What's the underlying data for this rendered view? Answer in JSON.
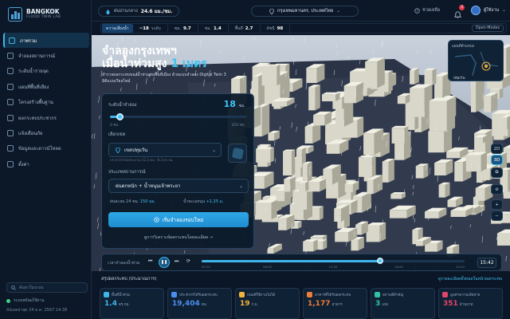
{
  "sidebar": {
    "logo_title": "BANGKOK",
    "logo_subtitle": "FLOOD TWIN LAB",
    "items": [
      {
        "label": "ภาพรวม",
        "active": true
      },
      {
        "label": "จำลองสถานการณ์"
      },
      {
        "label": "ระดับน้ำรายจุด"
      },
      {
        "label": "แผนที่พื้นที่เสี่ยง"
      },
      {
        "label": "โครงสร้างพื้นฐาน"
      },
      {
        "label": "ผลกระทบประชากร"
      },
      {
        "label": "แจ้งเตือนภัย"
      },
      {
        "label": "ข้อมูลและดาวน์โหลด"
      },
      {
        "label": "ตั้งค่า"
      }
    ],
    "search_placeholder": "ค้นหาในระบบ",
    "status": "ระบบพร้อมใช้งาน",
    "updated": "อัปเดตล่าสุด 24 ต.ค. 2567 14:38"
  },
  "topbar": {
    "rain_label": "ฝนปานกลาง",
    "rain_value": "24.6 มม./ชม.",
    "location": "กรุงเทพมหานคร, ประเทศไทย",
    "help": "ช่วยเหลือ",
    "notifications": "3",
    "user": "ผู้ใช้งาน"
  },
  "metrics": {
    "label": "ความเสี่ยงน้ำ",
    "items": [
      {
        "label": "ระดับ",
        "value": "~18"
      },
      {
        "label": "ซม.",
        "value": "9.7"
      },
      {
        "label": "ชม.",
        "value": "1.4"
      },
      {
        "label": "พื้นที่",
        "value": "2.7"
      },
      {
        "label": "ดัชนี",
        "value": "98"
      }
    ],
    "mode": "Open-Modes"
  },
  "hero": {
    "title_line1": "จำลองกรุงเทพฯ",
    "title_line2_prefix": "เมื่อน้ำท่วมสูง",
    "title_line2_highlight": "1 เมตร",
    "subtitle": "สำรวจผลกระทบของน้ำท่วมต่อพื้นที่เมือง ด้วยแบบจำลอง Digital Twin 3 มิติแบบเรียลไทม์"
  },
  "panel": {
    "level_label": "ระดับน้ำจำลอง",
    "level_value": "18",
    "level_unit": "ซม.",
    "level_fraction": 0.07,
    "min_label": "0 ซม.",
    "max_label": "250 ซม.",
    "district_label": "เลือกเขต",
    "district_value": "เขตปทุมวัน",
    "district_note": "ประชากรโดยประมาณ 12,3 คน · 8.3 ตร.กม.",
    "scenario_label": "ประเภทสถานการณ์",
    "scenario_value": "ฝนตกหนัก + น้ำหนุนเจ้าพระยา",
    "chip1_label": "ฝนสะสม 24 ชม.",
    "chip1_value": "150 มม.",
    "chip2_label": "น้ำทะเลหนุน",
    "chip2_value": "+1.25 ม.",
    "run_button": "เริ่มจำลองรอบใหม่",
    "details_link": "ดูการวิเคราะห์ผลกระทบโดยละเอียด →"
  },
  "minimap": {
    "title": "แผนที่ตำแหน่ง",
    "label": "ปทุมวัน"
  },
  "controls": [
    "2D",
    "3D",
    "⧉",
    "⊘",
    "+",
    "−"
  ],
  "timeline": {
    "label": "เวลาจำลองน้ำท่วม",
    "progress": 0.68,
    "ticks": [
      "00:00",
      "06:00",
      "12:00",
      "18:00",
      "24:00"
    ],
    "current_time": "15:42"
  },
  "summary": {
    "title": "สรุปผลกระทบ (ประมาณการ)",
    "link": "ดูรายละเอียดทั้งหมดในหน้าผลกระทบ",
    "cards": [
      {
        "label": "พื้นที่น้ำท่วม",
        "value": "1.4",
        "unit": "ตร.กม.",
        "color": "#3fb6ea"
      },
      {
        "label": "ประชากรได้รับผลกระทบ",
        "value": "19,404",
        "unit": "คน",
        "color": "#4a8ef0"
      },
      {
        "label": "ถนนที่ใช้งานไม่ได้",
        "value": "19",
        "unit": "ก.ม.",
        "color": "#f2b23c"
      },
      {
        "label": "อาคารที่ได้รับผลกระทบ",
        "value": "1,177",
        "unit": "อาคาร",
        "color": "#f07c3a"
      },
      {
        "label": "สถานที่สำคัญ",
        "value": "3",
        "unit": "แห่ง",
        "color": "#2fc4a8"
      },
      {
        "label": "มูลค่าความเสียหาย",
        "value": "351",
        "unit": "ล้านบาท",
        "color": "#e2456a"
      }
    ]
  }
}
